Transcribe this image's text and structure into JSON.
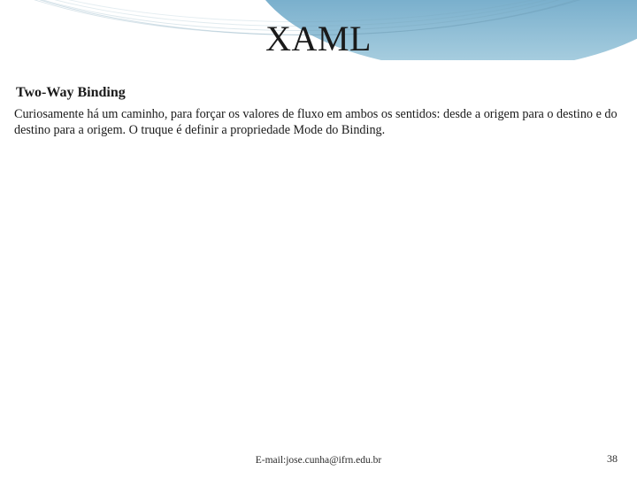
{
  "slide": {
    "title": "XAML",
    "subtitle": "Two-Way Binding",
    "body": "Curiosamente há um caminho, para forçar os valores de fluxo em ambos os sentidos: desde a origem para o destino e do destino para a origem. O truque é definir a propriedade Mode do Binding."
  },
  "footer": {
    "email": "E-mail:jose.cunha@ifrn.edu.br",
    "page_number": "38"
  }
}
